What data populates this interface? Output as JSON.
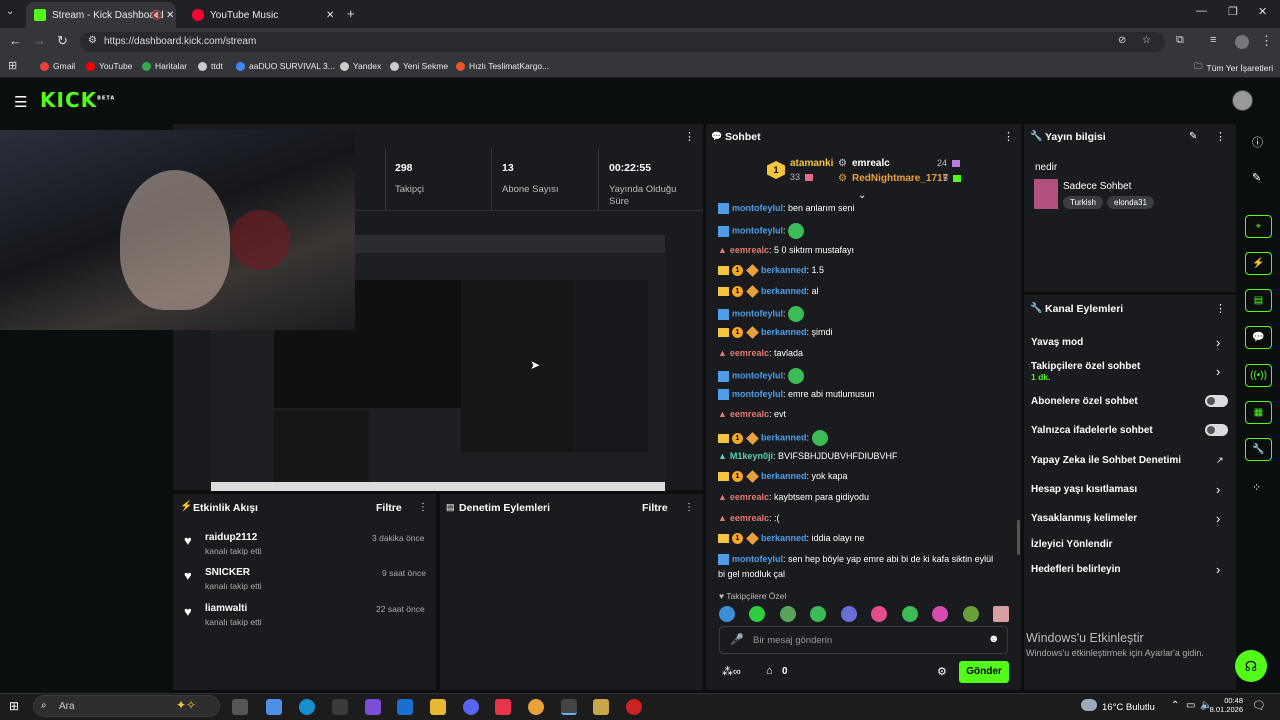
{
  "browser": {
    "tabs": [
      {
        "title": "Stream - Kick Dashboard"
      },
      {
        "title": "YouTube Music"
      }
    ],
    "url": "https://dashboard.kick.com/stream",
    "bookmarks": [
      "Gmail",
      "YouTube",
      "Haritalar",
      "ttdt",
      "aaDUO SURVIVAL 3...",
      "Yandex",
      "Yeni Sekme",
      "Hızlı TeslimatKargo..."
    ],
    "all_bookmarks": "Tüm Yer İşaretleri"
  },
  "kick": {
    "logo": "KICK",
    "beta": "BETA"
  },
  "stream": {
    "stats": [
      {
        "value": "298",
        "label": "Takipçi"
      },
      {
        "value": "13",
        "label": "Abone Sayısı"
      },
      {
        "value": "00:22:55",
        "label": "Yayında Olduğu Süre"
      }
    ]
  },
  "activity": {
    "title": "Etkinlik Akışı",
    "filter": "Filtre",
    "items": [
      {
        "user": "raidup2112",
        "action": "kanalı takip etti",
        "time": "3 dakika önce"
      },
      {
        "user": "SNICKER",
        "action": "kanalı takip etti",
        "time": "9 saat önce"
      },
      {
        "user": "liamwalti",
        "action": "kanalı takip etti",
        "time": "22 saat önce"
      }
    ]
  },
  "moderation": {
    "title": "Denetim Eylemleri",
    "filter": "Filtre"
  },
  "chat": {
    "title": "Sohbet",
    "leaderboard": {
      "first": {
        "rank": "1",
        "name": "atamanki",
        "count": "33"
      },
      "second": {
        "name": "emrealc",
        "count": "24"
      },
      "third": {
        "name": "RedNightmare_1717",
        "count": "5"
      }
    },
    "messages": [
      {
        "user": "montofeylul",
        "text": ": ben anlarım seni"
      },
      {
        "user": "montofeylul",
        "text": ":"
      },
      {
        "user": "eemrealc",
        "text": ": 5 0 siktım mustafayı"
      },
      {
        "user": "berkanned",
        "text": ": 1.5"
      },
      {
        "user": "berkanned",
        "text": ": al"
      },
      {
        "user": "montofeylul",
        "text": ":"
      },
      {
        "user": "berkanned",
        "text": ": şimdi"
      },
      {
        "user": "eemrealc",
        "text": ": tavlada"
      },
      {
        "user": "montofeylul",
        "text": ":"
      },
      {
        "user": "montofeylul",
        "text": ": emre abi mutlumusun"
      },
      {
        "user": "eemrealc",
        "text": ": evt"
      },
      {
        "user": "berkanned",
        "text": ":"
      },
      {
        "user": "M1keyn0ji",
        "text": ": BVIFSBHJDUBVHFDIUBVHF"
      },
      {
        "user": "berkanned",
        "text": ": yok kapa"
      },
      {
        "user": "eemrealc",
        "text": ": kaybtsem para gidiyodu"
      },
      {
        "user": "eemrealc",
        "text": ": :("
      },
      {
        "user": "berkanned",
        "text": ": iddia olayı ne"
      },
      {
        "user": "montofeylul",
        "text": ": sen hep böyle yap emre abi bi de ki kafa siktin eylül"
      },
      {
        "user": "",
        "text": "bi gel modluk çal"
      }
    ],
    "followers_only": "Takipçilere Özel",
    "input_placeholder": "Bir mesaj gönderin",
    "points": "0",
    "send": "Gönder"
  },
  "stream_info": {
    "title": "Yayın bilgisi",
    "stream_title": "nedir",
    "category": "Sadece Sohbet",
    "tags": [
      "Turkish",
      "elonda31"
    ]
  },
  "channel_actions": {
    "title": "Kanal Eylemleri",
    "items": [
      {
        "label": "Yavaş mod",
        "control": "chevron"
      },
      {
        "label": "Takipçilere özel sohbet",
        "sub": "1 dk.",
        "control": "chevron"
      },
      {
        "label": "Abonelere özel sohbet",
        "control": "toggle"
      },
      {
        "label": "Yalnızca ifadelerle sohbet",
        "control": "toggle"
      },
      {
        "label": "Yapay Zeka ile Sohbet Denetimi",
        "control": "external"
      },
      {
        "label": "Hesap yaşı kısıtlaması",
        "control": "chevron"
      },
      {
        "label": "Yasaklanmış kelimeler",
        "control": "chevron"
      },
      {
        "label": "İzleyici Yönlendir",
        "control": "none"
      },
      {
        "label": "Hedefleri belirleyin",
        "control": "chevron"
      }
    ]
  },
  "watermark": {
    "line1": "Windows'u Etkinleştir",
    "line2": "Windows'u etkinleştirmek için Ayarlar'a gidin."
  },
  "taskbar": {
    "search": "Ara",
    "weather": "16°C  Bulutlu",
    "time": "00:48",
    "date": "8.01.2026"
  }
}
